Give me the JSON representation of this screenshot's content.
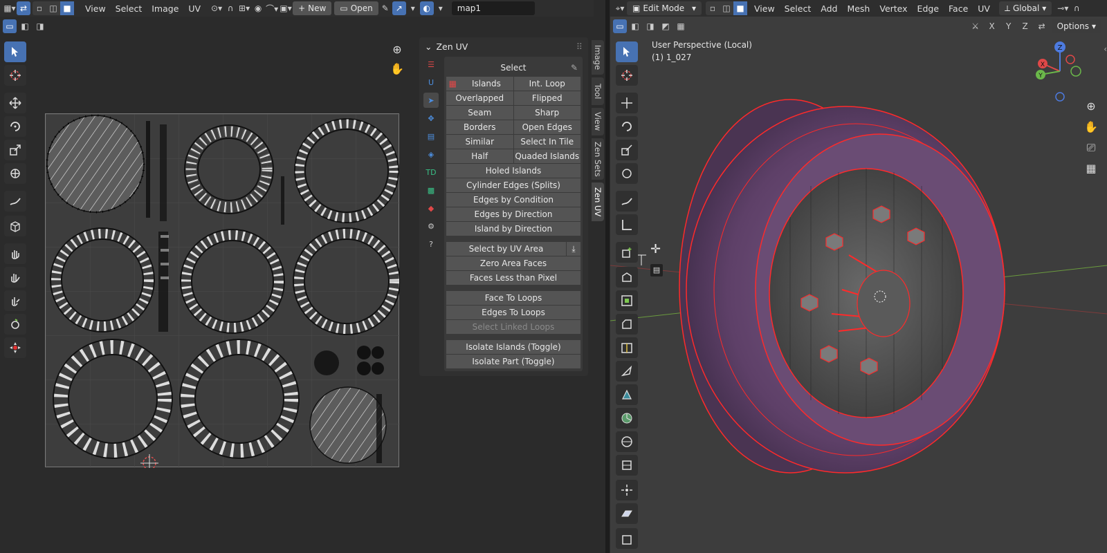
{
  "uv_header": {
    "menus": [
      "View",
      "Select",
      "Image",
      "UV"
    ],
    "new_label": "New",
    "open_label": "Open",
    "image_name": "map1"
  },
  "zen": {
    "title": "Zen UV",
    "section": "Select",
    "pairs": [
      [
        "Islands",
        "Int. Loop"
      ],
      [
        "Overlapped",
        "Flipped"
      ],
      [
        "Seam",
        "Sharp"
      ],
      [
        "Borders",
        "Open Edges"
      ],
      [
        "Similar",
        "Select In Tile"
      ],
      [
        "Half",
        "Quaded Islands"
      ]
    ],
    "singles_a": [
      "Holed Islands",
      "Cylinder Edges (Splits)",
      "Edges by Condition",
      "Edges by Direction",
      "Island by Direction"
    ],
    "uv_area": "Select by UV Area",
    "singles_b": [
      "Zero Area Faces",
      "Faces Less than Pixel"
    ],
    "loops": [
      "Face To Loops",
      "Edges To Loops",
      "Select Linked Loops"
    ],
    "isolate": [
      "Isolate Islands (Toggle)",
      "Isolate Part (Toggle)"
    ]
  },
  "right_tabs": [
    "Image",
    "Tool",
    "View",
    "Zen Sets",
    "Zen UV"
  ],
  "view3d_header": {
    "mode": "Edit Mode",
    "menus": [
      "View",
      "Select",
      "Add",
      "Mesh",
      "Vertex",
      "Edge",
      "Face",
      "UV"
    ],
    "orientation": "Global",
    "axes": [
      "X",
      "Y",
      "Z"
    ],
    "options": "Options"
  },
  "viewport": {
    "perspective": "User Perspective (Local)",
    "object": "(1) 1_027"
  },
  "gizmo": {
    "x": "X",
    "y": "Y",
    "z": "Z"
  },
  "colors": {
    "accent": "#4772b3",
    "edge_selected": "#ff2a2a",
    "panel": "#303030",
    "button": "#545454"
  }
}
